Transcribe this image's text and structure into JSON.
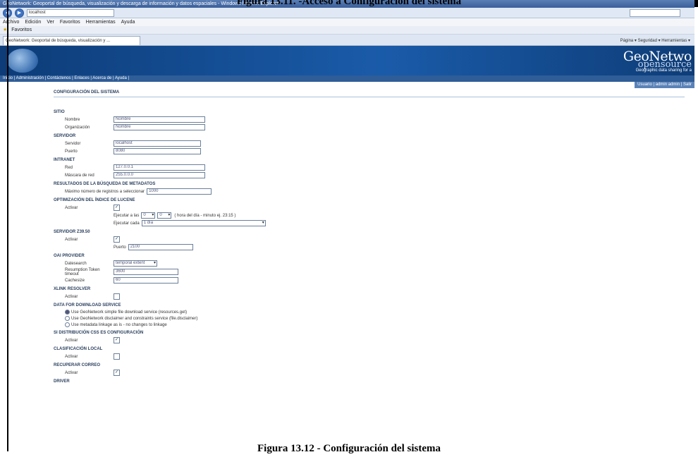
{
  "captions": {
    "top": "Figura 13.11. -Acceso a Configuración del sistema",
    "bottom": "Figura 13.12 - Configuración del sistema"
  },
  "browser": {
    "window_title": "GeoNetwork: Geoportal de búsqueda, visualización y descarga de información y datos espaciales - Windows Internet Explorer",
    "url": "localhost",
    "menu": [
      "Archivo",
      "Edición",
      "Ver",
      "Favoritos",
      "Herramientas",
      "Ayuda"
    ],
    "favorites": [
      "Favoritos"
    ],
    "tab_title": "GeoNetwork: Geoportal de búsqueda, visualización y ...",
    "tools_text": "Página ▾  Seguridad ▾  Herramientas ▾"
  },
  "banner": {
    "logo_line1": "GeoNetwo",
    "logo_line2": "opensource",
    "tagline": "Geographic data sharing for a",
    "top_nav": "Inicio | Administración | Contáctenos | Enlaces | Acerca de | Ayuda |",
    "sub_nav": "Usuario | admin admin | Salir"
  },
  "config": {
    "page_title": "CONFIGURACIÓN DEL SISTEMA",
    "site": {
      "heading": "SITIO",
      "name_label": "Nombre",
      "name_value": "Nombre",
      "org_label": "Organización",
      "org_value": "Nombre"
    },
    "server": {
      "heading": "SERVIDOR",
      "host_label": "Servidor",
      "host_value": "localhost",
      "port_label": "Puerto",
      "port_value": "8080"
    },
    "intranet": {
      "heading": "INTRANET",
      "net_label": "Red",
      "net_value": "127.0.0.1",
      "mask_label": "Máscara de red",
      "mask_value": "255.0.0.0"
    },
    "search": {
      "heading": "RESULTADOS DE LA BÚSQUEDA DE METADATOS",
      "max_label": "Máximo número de registros a seleccionar",
      "max_value": "1000"
    },
    "index": {
      "heading": "OPTIMIZACIÓN DEL ÍNDICE DE LUCENE",
      "enable_label": "Activar",
      "run_at_label": "Ejecutar a las",
      "hour": "0",
      "minute": "0",
      "run_at_hint": "( hora del día - minuto ej. 23:15 )",
      "interval_label": "Ejecutar cada",
      "interval_value": "1 día"
    },
    "z3950": {
      "heading": "SERVIDOR Z39.50",
      "enable_label": "Activar",
      "port_label": "Puerto",
      "port_value": "2100"
    },
    "oai": {
      "heading": "OAI PROVIDER",
      "datestamp_label": "Datesearch",
      "datestamp_value": "temporal extent",
      "token_label": "Resumption Token timeout",
      "token_value": "3600",
      "cache_label": "Cachesize",
      "cache_value": "60"
    },
    "xlink": {
      "heading": "XLINK RESOLVER",
      "enable_label": "Activar"
    },
    "download": {
      "heading": "DATA FOR DOWNLOAD SERVICE",
      "options": [
        "Use GeoNetwork simple file download service (resources.get)",
        "Use GeoNetwork disclaimer and constraints service (file.disclaimer)",
        "Use metadata linkage as is - no changes to linkage"
      ]
    },
    "autofixing": {
      "heading": "SI DISTRIBUCIÓN CSS ES CONFIGURACIÓN",
      "enable_label": "Activar"
    },
    "localrating": {
      "heading": "CLASIFICACIÓN LOCAL",
      "enable_label": "Activar"
    },
    "clickable": {
      "heading": "RECUPERAR CORREO",
      "enable_label": "Activar"
    },
    "last_heading": "DRIVER"
  }
}
